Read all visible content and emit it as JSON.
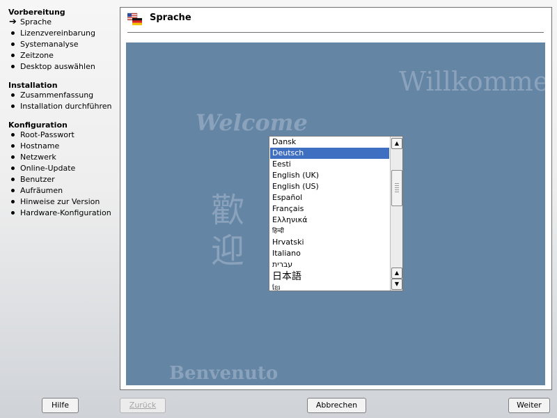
{
  "sidebar": {
    "sections": [
      {
        "title": "Vorbereitung",
        "steps": [
          "Sprache",
          "Lizenzvereinbarung",
          "Systemanalyse",
          "Zeitzone",
          "Desktop auswählen"
        ]
      },
      {
        "title": "Installation",
        "steps": [
          "Zusammenfassung",
          "Installation durchführen"
        ]
      },
      {
        "title": "Konfiguration",
        "steps": [
          "Root-Passwort",
          "Hostname",
          "Netzwerk",
          "Online-Update",
          "Benutzer",
          "Aufräumen",
          "Hinweise zur Version",
          "Hardware-Konfiguration"
        ]
      }
    ],
    "current_step": "Sprache"
  },
  "main": {
    "title": "Sprache",
    "banner_words": {
      "top": "Willkommen",
      "left": "Welcome",
      "kanji": "歡迎",
      "bottom": "Benvenuto"
    },
    "language_list": {
      "items": [
        "Dansk",
        "Deutsch",
        "Eesti",
        "English (UK)",
        "English (US)",
        "Español",
        "Français",
        "Ελληνικά",
        "हिन्दी",
        "Hrvatski",
        "Italiano",
        "עברית",
        "日本語",
        "ខ្មែរ"
      ],
      "selected": "Deutsch"
    }
  },
  "buttons": {
    "help": "Hilfe",
    "back": "Zurück",
    "cancel": "Abbrechen",
    "next": "Weiter"
  },
  "colors": {
    "banner": "#6585a5",
    "selection": "#3f6fc1"
  }
}
